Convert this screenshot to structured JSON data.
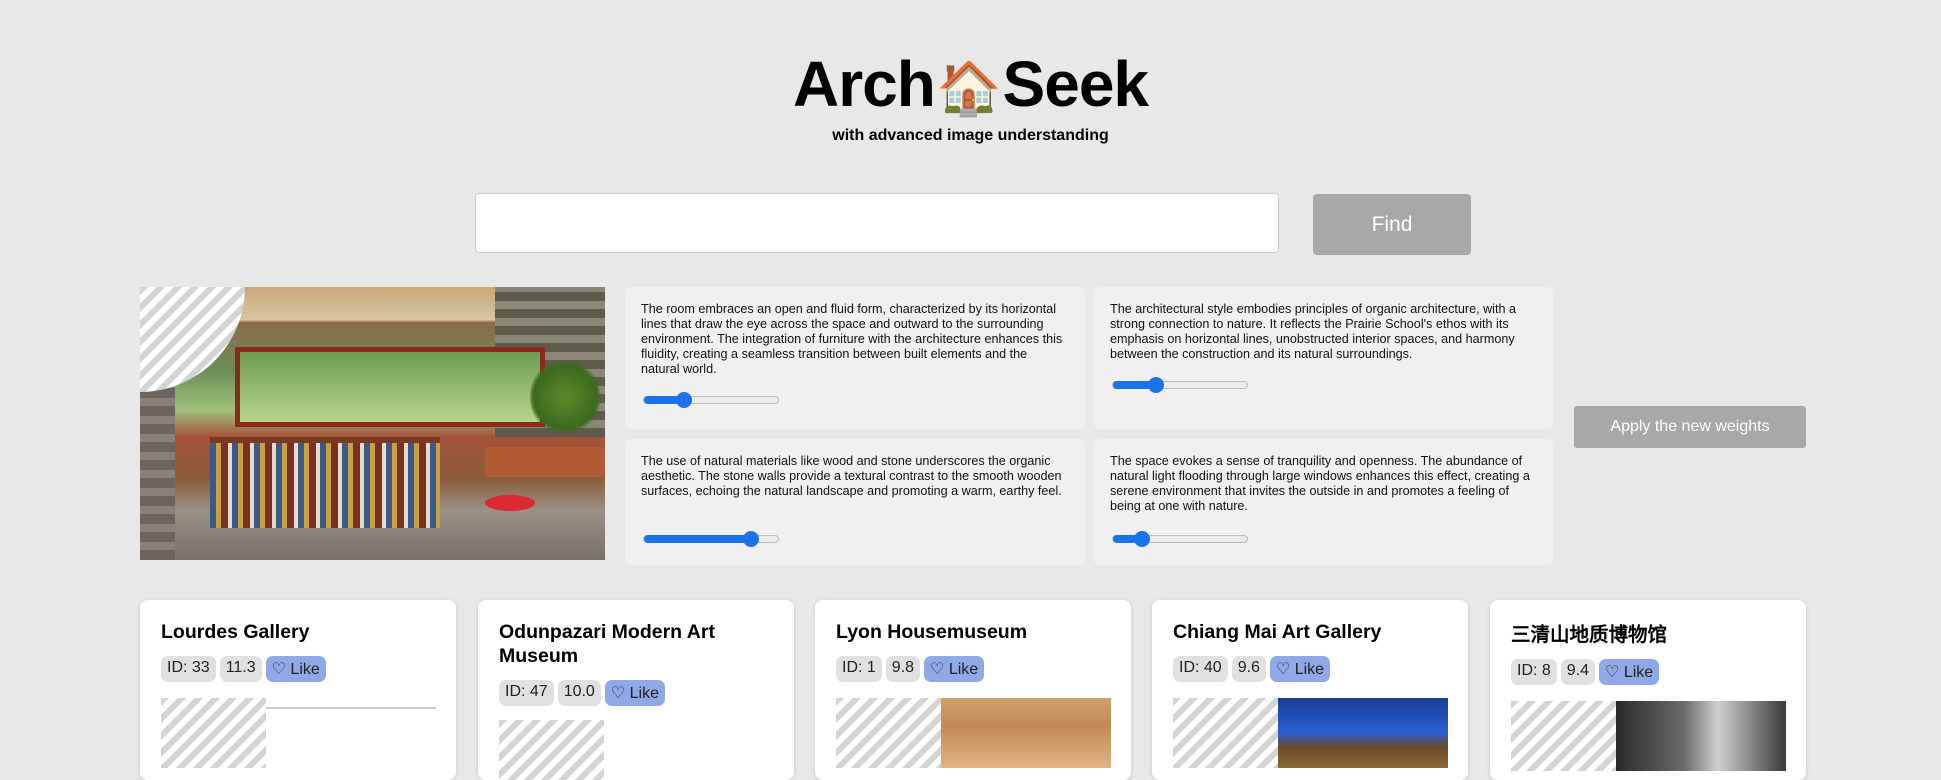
{
  "header": {
    "title_left": "Arch",
    "title_icon": "🏠",
    "title_right": "Seek",
    "subtitle": "with advanced image understanding"
  },
  "search": {
    "value": "",
    "placeholder": "",
    "button_label": "Find"
  },
  "query": {
    "descriptions": [
      {
        "text": "The room embraces an open and fluid form, characterized by its horizontal lines that draw the eye across the space and outward to the surrounding environment. The integration of furniture with the architecture enhances this fluidity, creating a seamless transition between built elements and the natural world.",
        "weight": 0.3
      },
      {
        "text": "The architectural style embodies principles of organic architecture, with a strong connection to nature. It reflects the Prairie School's ethos with its emphasis on horizontal lines, unobstructed interior spaces, and harmony between the construction and its natural surroundings.",
        "weight": 0.32
      },
      {
        "text": "The use of natural materials like wood and stone underscores the organic aesthetic. The stone walls provide a textural contrast to the smooth wooden surfaces, echoing the natural landscape and promoting a warm, earthy feel.",
        "weight": 0.8
      },
      {
        "text": "The space evokes a sense of tranquility and openness. The abundance of natural light flooding through large windows enhances this effect, creating a serene environment that invites the outside in and promotes a feeling of being at one with nature.",
        "weight": 0.22
      }
    ],
    "apply_label": "Apply the new weights"
  },
  "results": [
    {
      "title": "Lourdes Gallery",
      "id": "ID: 33",
      "score": "11.3",
      "like": "♡ Like"
    },
    {
      "title": "Odunpazari Modern Art Museum",
      "id": "ID: 47",
      "score": "10.0",
      "like": "♡ Like"
    },
    {
      "title": "Lyon Housemuseum",
      "id": "ID: 1",
      "score": "9.8",
      "like": "♡ Like"
    },
    {
      "title": "Chiang Mai Art Gallery",
      "id": "ID: 40",
      "score": "9.6",
      "like": "♡ Like"
    },
    {
      "title": "三清山地质博物馆",
      "id": "ID: 8",
      "score": "9.4",
      "like": "♡ Like"
    }
  ],
  "colors": {
    "accent": "#1a73e8",
    "like_bg": "#8fa8e6",
    "button_bg": "#a8a8a8"
  }
}
